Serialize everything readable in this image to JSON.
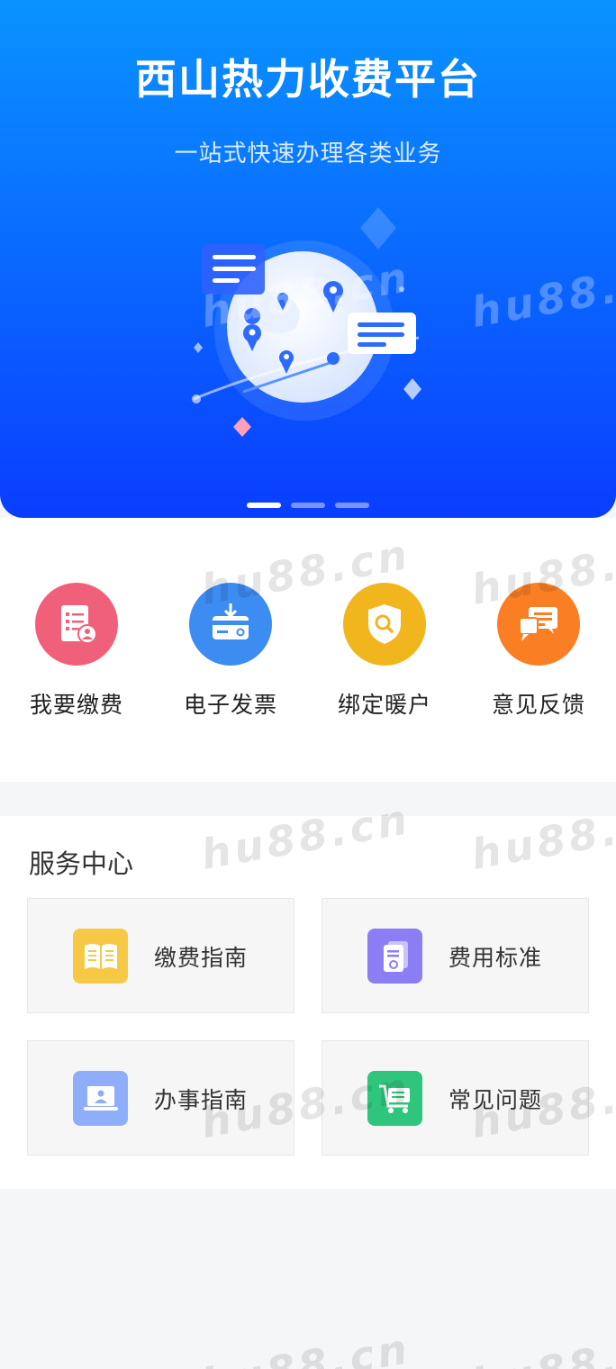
{
  "banner": {
    "title": "西山热力收费平台",
    "subtitle": "一站式快速办理各类业务",
    "slide_count": 3,
    "active_slide": 1
  },
  "quick_actions": [
    {
      "label": "我要缴费",
      "icon": "bill-payment-icon",
      "color": "#f1607a"
    },
    {
      "label": "电子发票",
      "icon": "e-invoice-icon",
      "color": "#3d8cf2"
    },
    {
      "label": "绑定暖户",
      "icon": "shield-search-icon",
      "color": "#f1b51d"
    },
    {
      "label": "意见反馈",
      "icon": "feedback-chat-icon",
      "color": "#f97e24"
    }
  ],
  "service_center": {
    "title": "服务中心",
    "cards": [
      {
        "label": "缴费指南",
        "icon": "book-icon",
        "color": "#f7c843"
      },
      {
        "label": "费用标准",
        "icon": "document-icon",
        "color": "#8b7ef4"
      },
      {
        "label": "办事指南",
        "icon": "laptop-user-icon",
        "color": "#8eaef9"
      },
      {
        "label": "常见问题",
        "icon": "cart-icon",
        "color": "#2fc57c"
      }
    ]
  },
  "watermark": "hu88.cn"
}
